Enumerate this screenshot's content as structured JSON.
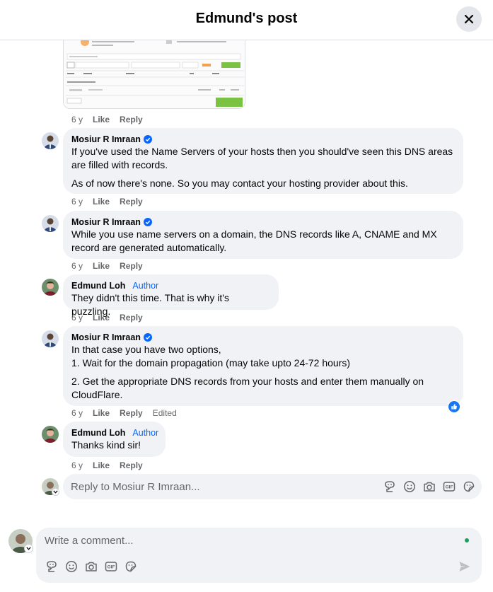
{
  "header": {
    "title": "Edmund's post",
    "close_icon": "close-icon"
  },
  "comments": [
    {
      "author": "Mosiur R Imraan",
      "verified": true,
      "paragraphs": [
        "If you've used the Name Servers of your hosts then you should've seen this DNS areas are filled with records.",
        "As of now there's none. So you may contact your hosting provider about this."
      ],
      "time": "6 y",
      "like": "Like",
      "reply": "Reply"
    },
    {
      "author": "Mosiur R Imraan",
      "verified": true,
      "paragraphs": [
        "While you use name servers on a domain, the DNS records like A, CNAME and MX record are generated automatically."
      ],
      "time": "6 y",
      "like": "Like",
      "reply": "Reply"
    },
    {
      "author": "Edmund Loh",
      "badge": "Author",
      "paragraphs": [
        "They didn't this time. That is why it's puzzling."
      ],
      "time": "6 y",
      "like": "Like",
      "reply": "Reply"
    },
    {
      "author": "Mosiur R Imraan",
      "verified": true,
      "paragraphs": [
        "In that case you have two options,",
        "1. Wait for the domain propagation (may take upto 24-72 hours)",
        "2. Get the appropriate DNS records from your hosts and enter them manually on CloudFlare."
      ],
      "time": "6 y",
      "like": "Like",
      "reply": "Reply",
      "edited": "Edited",
      "reaction": "like-reaction-icon"
    },
    {
      "author": "Edmund Loh",
      "badge": "Author",
      "paragraphs": [
        "Thanks kind sir!"
      ],
      "time": "6 y",
      "like": "Like",
      "reply": "Reply"
    }
  ],
  "image_comment": {
    "time": "6 y",
    "like": "Like",
    "reply": "Reply"
  },
  "reply_box": {
    "placeholder": "Reply to Mosiur R Imraan..."
  },
  "comment_box": {
    "placeholder": "Write a comment..."
  },
  "composer_tools": [
    "avatar-sticker-icon",
    "emoji-icon",
    "camera-icon",
    "gif-icon",
    "sticker-icon"
  ],
  "colors": {
    "accent": "#0866ff",
    "bubble": "#f0f2f5",
    "secondary_text": "#65676b",
    "online": "#1f9e5a"
  }
}
